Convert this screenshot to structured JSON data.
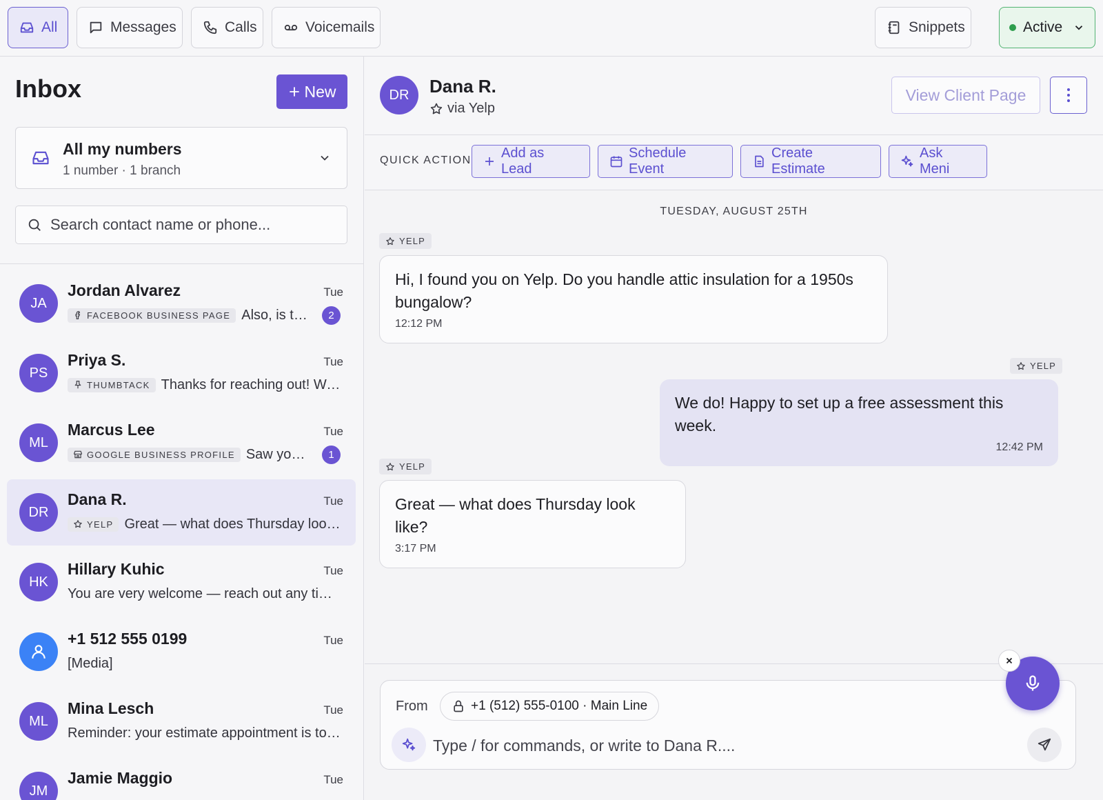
{
  "topbar": {
    "tabs": [
      {
        "label": "All",
        "icon": "inbox-icon",
        "active": true
      },
      {
        "label": "Messages",
        "icon": "message-icon",
        "active": false
      },
      {
        "label": "Calls",
        "icon": "phone-icon",
        "active": false
      },
      {
        "label": "Voicemails",
        "icon": "voicemail-icon",
        "active": false
      }
    ],
    "snippets_label": "Snippets",
    "status_label": "Active"
  },
  "inbox": {
    "title": "Inbox",
    "new_label": "New",
    "numbers_title": "All my numbers",
    "numbers_sub": "1 number · 1 branch",
    "search_placeholder": "Search contact name or phone..."
  },
  "conversations": [
    {
      "initials": "JA",
      "name": "Jordan Alvarez",
      "date": "Tue",
      "source": "FACEBOOK BUSINESS PAGE",
      "source_icon": "facebook-icon",
      "preview": "Also, is there a discount for",
      "unread": "2",
      "selected": false
    },
    {
      "initials": "PS",
      "name": "Priya S.",
      "date": "Tue",
      "source": "THUMBTACK",
      "source_icon": "pin-icon",
      "preview": "Thanks for reaching out! We can",
      "unread": "",
      "selected": false
    },
    {
      "initials": "ML",
      "name": "Marcus Lee",
      "date": "Tue",
      "source": "GOOGLE BUSINESS PROFILE",
      "source_icon": "store-icon",
      "preview": "Saw your reviews",
      "unread": "1",
      "selected": false
    },
    {
      "initials": "DR",
      "name": "Dana R.",
      "date": "Tue",
      "source": "YELP",
      "source_icon": "star-icon",
      "preview": "Great — what does Thursday look like?",
      "unread": "",
      "selected": true
    },
    {
      "initials": "HK",
      "name": "Hillary Kuhic",
      "date": "Tue",
      "source": "",
      "source_icon": "",
      "preview": "You are very welcome — reach out any time!",
      "unread": "",
      "selected": false
    },
    {
      "initials": "",
      "name": "+1 512 555 0199",
      "date": "Tue",
      "source": "",
      "source_icon": "",
      "preview": "[Media]",
      "unread": "",
      "selected": false,
      "avatar_icon": "person-icon"
    },
    {
      "initials": "ML",
      "name": "Mina Lesch",
      "date": "Tue",
      "source": "",
      "source_icon": "",
      "preview": "Reminder: your estimate appointment is tomorrow",
      "unread": "",
      "selected": false
    },
    {
      "initials": "JM",
      "name": "Jamie Maggio",
      "date": "Tue",
      "source": "",
      "source_icon": "",
      "preview": "",
      "unread": "",
      "selected": false
    }
  ],
  "chat": {
    "initials": "DR",
    "name": "Dana R.",
    "via": "via Yelp",
    "view_client_label": "View Client Page",
    "quick_actions_label": "QUICK ACTIONS:",
    "quick_actions": [
      {
        "label": "Add as Lead",
        "icon": "plus-icon"
      },
      {
        "label": "Schedule Event",
        "icon": "calendar-icon"
      },
      {
        "label": "Create Estimate",
        "icon": "document-icon"
      },
      {
        "label": "Ask Meni",
        "icon": "sparkle-icon"
      }
    ],
    "day_label": "TUESDAY, AUGUST 25TH",
    "messages": [
      {
        "direction": "in",
        "tag": "YELP",
        "text": "Hi, I found you on Yelp. Do you handle attic insulation for a 1950s bungalow?",
        "time": "12:12 PM"
      },
      {
        "direction": "out",
        "tag": "YELP",
        "text": "We do! Happy to set up a free assessment this week.",
        "time": "12:42 PM"
      },
      {
        "direction": "in",
        "tag": "YELP",
        "text": "Great — what does Thursday look like?",
        "time": "3:17 PM"
      }
    ]
  },
  "composer": {
    "from_label": "From",
    "from_number": "+1 (512) 555-0100 · Main Line",
    "placeholder": "Type / for commands, or write to Dana R...."
  }
}
